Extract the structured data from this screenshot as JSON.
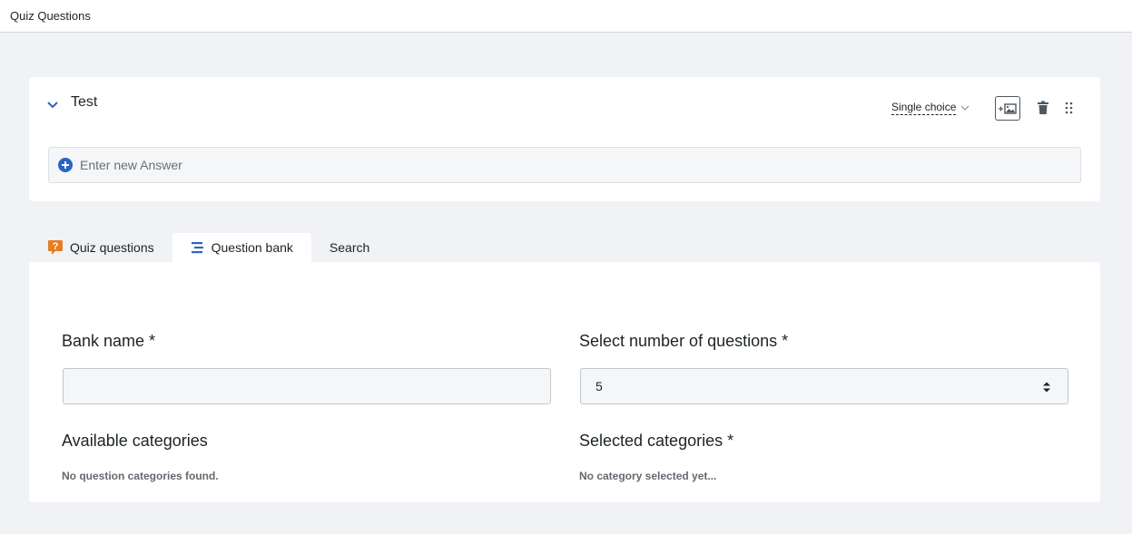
{
  "header": {
    "title": "Quiz Questions"
  },
  "question": {
    "title": "Test",
    "type_label": "Single choice",
    "answer_placeholder": "Enter new Answer"
  },
  "tabs": [
    {
      "label": "Quiz questions",
      "icon": "question-badge-icon"
    },
    {
      "label": "Question bank",
      "icon": "list-lines-icon",
      "active": true
    },
    {
      "label": "Search"
    }
  ],
  "bank": {
    "bank_name_label": "Bank name *",
    "bank_name_value": "",
    "num_questions_label": "Select number of questions *",
    "num_questions_value": "5",
    "available_label": "Available categories",
    "available_empty": "No question categories found.",
    "selected_label": "Selected categories *",
    "selected_empty": "No category selected yet..."
  },
  "colors": {
    "accent_blue": "#2c64c5",
    "quiz_icon_orange": "#e67e22",
    "page_bg": "#f0f2f5"
  }
}
